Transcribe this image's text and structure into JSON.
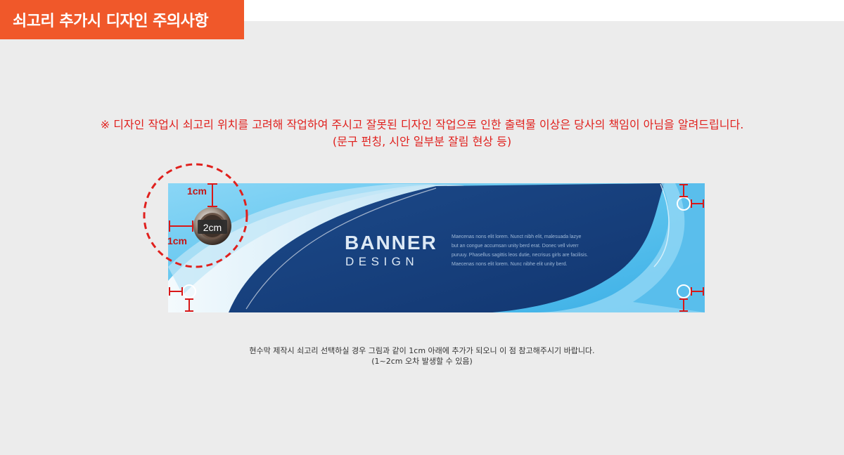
{
  "header": {
    "title": "쇠고리 추가시 디자인 주의사항"
  },
  "notice": {
    "line1": "※ 디자인 작업시 쇠고리 위치를 고려해 작업하여 주시고  잘못된 디자인 작업으로 인한 출력물 이상은 당사의 책임이 아님을 알려드립니다.",
    "line2": "(문구 펀칭, 시안 일부분 잘림 현상 등)"
  },
  "banner": {
    "headline": "BANNER",
    "subheadline": "DESIGN",
    "body_lines": [
      "Maecenas nons elit lorem. Nunct nibh elit, malesuada lazye",
      "but an congue accumsan unity berd erat. Donec vell viverr",
      "puruuy. Phasellus sagittis leos dutie, necrisus girls are facilisis.",
      "Maecenas nons elit lorem. Nunc nibhe elit unity berd."
    ]
  },
  "dimensions": {
    "top_label": "1cm",
    "left_label": "1cm",
    "grommet_label": "2cm"
  },
  "bottom_note": {
    "line1": "현수막 제작시 쇠고리 선택하실 경우 그림과 같이 1cm 아래에 추가가 되오니 이 점 참고해주시기 바랍니다.",
    "line2": "(1~2cm 오차 발생할 수 있음)"
  },
  "colors": {
    "accent": "#f0582a",
    "notice_red": "#e0201d",
    "marker_red": "#d81818",
    "banner_navy": "#173f7c",
    "banner_sky": "#5ec4ee"
  }
}
